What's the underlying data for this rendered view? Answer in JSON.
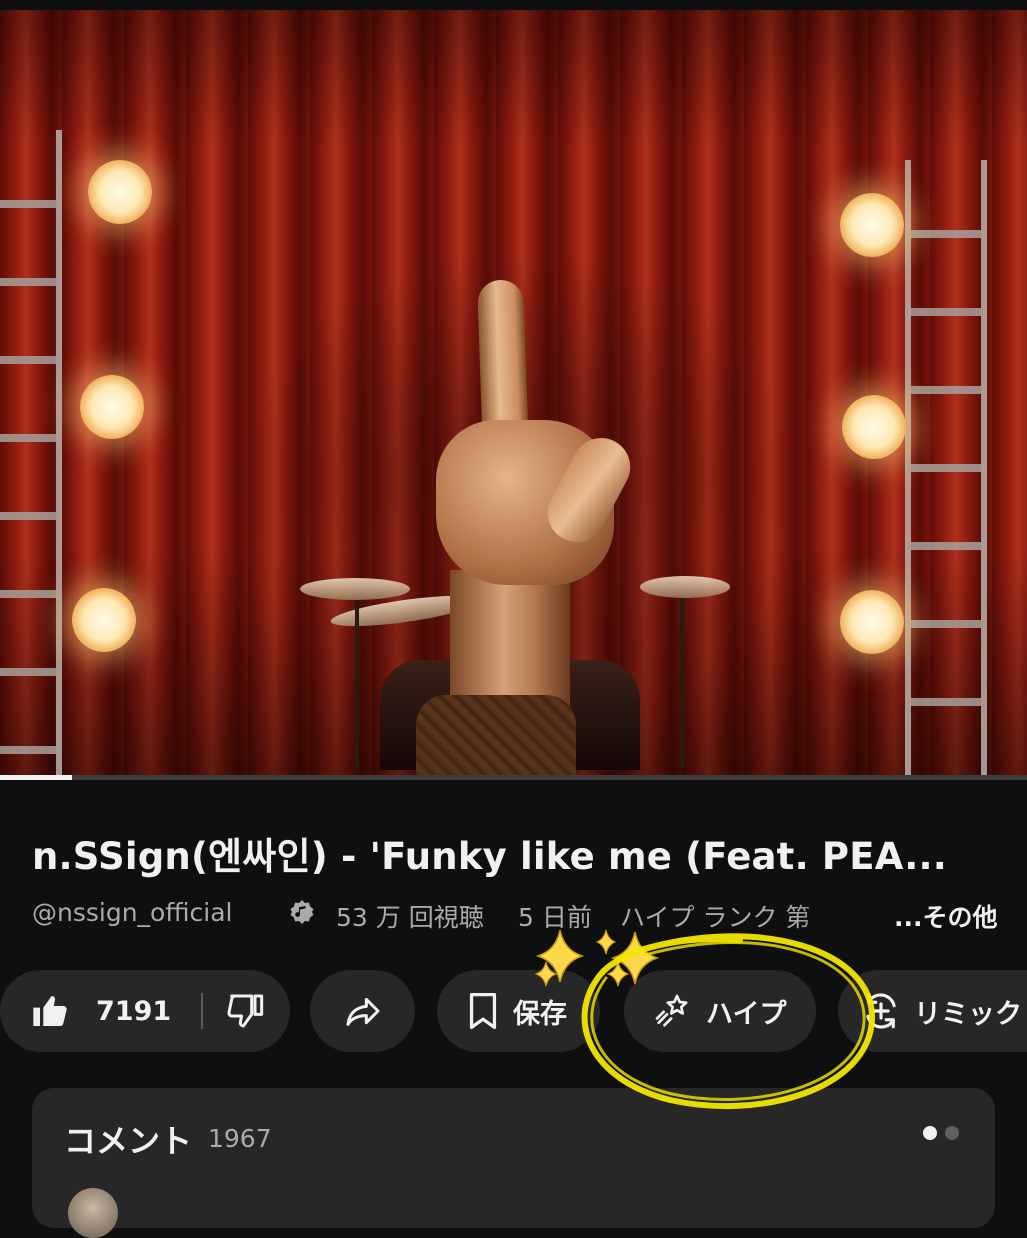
{
  "video": {
    "progress_fraction": 0.07
  },
  "title": "n.SSign(엔싸인) - 'Funky like me (Feat. PEA...",
  "meta": {
    "channel": "@nssign_official",
    "verified_icon": "music-note-verified-icon",
    "views": "53 万 回視聴",
    "age": "5 日前",
    "hype_rank": "ハイプ ランク 第",
    "more": "...その他"
  },
  "actions": {
    "like_count": "7191",
    "like_icon": "thumbs-up-filled-icon",
    "dislike_icon": "thumbs-down-icon",
    "share_icon": "share-arrow-icon",
    "save_label": "保存",
    "save_icon": "bookmark-icon",
    "hype_label": "ハイプ",
    "hype_icon": "hype-star-icon",
    "remix_label": "リミック",
    "remix_icon": "remix-icon"
  },
  "annotation": {
    "sparkle_emoji": "✨✨",
    "highlight_color": "#f2e600"
  },
  "comments": {
    "heading": "コメント",
    "count": "1967",
    "pager_dots": 2,
    "active_dot": 0
  }
}
